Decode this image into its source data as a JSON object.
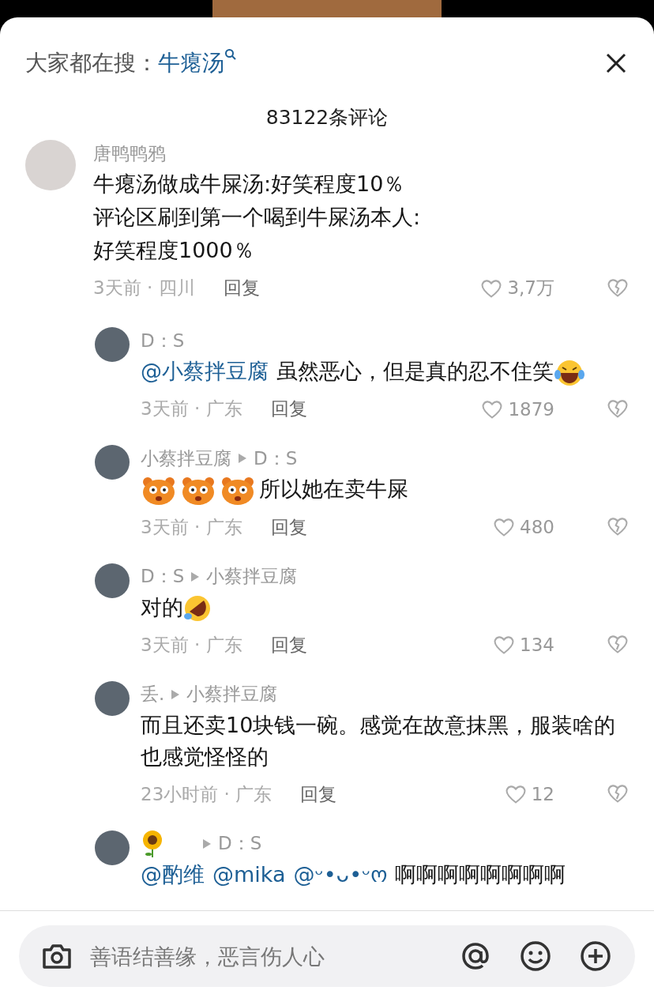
{
  "header": {
    "prompt": "大家都在搜：",
    "query": "牛瘪汤"
  },
  "comment_count": "83122条评论",
  "comments": [
    {
      "kind": "top",
      "author": {
        "kind": "text",
        "text": "唐鸭鸭鸦"
      },
      "body": [
        [
          {
            "kind": "text",
            "text": "牛瘪汤做成牛屎汤:好笑程度10％"
          }
        ],
        [
          {
            "kind": "text",
            "text": "评论区刷到第一个喝到牛屎汤本人:"
          }
        ],
        [
          {
            "kind": "text",
            "text": "好笑程度1000％"
          }
        ]
      ],
      "time_place": "3天前 · 四川",
      "reply": "回复",
      "likes": "3,7万"
    },
    {
      "kind": "reply",
      "author": {
        "kind": "text",
        "text": "D：S"
      },
      "body": [
        [
          {
            "kind": "mention",
            "text": "@小蔡拌豆腐"
          },
          {
            "kind": "text",
            "text": "虽然恶心，但是真的忍不住笑"
          },
          {
            "kind": "laugh"
          }
        ]
      ],
      "time_place": "3天前 · 广东",
      "reply": "回复",
      "likes": "1879"
    },
    {
      "kind": "reply",
      "author": {
        "kind": "text",
        "text": "小蔡拌豆腐"
      },
      "reply_to": "D：S",
      "body": [
        [
          {
            "kind": "bear"
          },
          {
            "kind": "bear"
          },
          {
            "kind": "bear"
          },
          {
            "kind": "text",
            "text": "所以她在卖牛屎"
          }
        ]
      ],
      "time_place": "3天前 · 广东",
      "reply": "回复",
      "likes": "480"
    },
    {
      "kind": "reply",
      "author": {
        "kind": "text",
        "text": "D：S"
      },
      "reply_to": "小蔡拌豆腐",
      "body": [
        [
          {
            "kind": "text",
            "text": "对的"
          },
          {
            "kind": "rofl"
          }
        ]
      ],
      "time_place": "3天前 · 广东",
      "reply": "回复",
      "likes": "134"
    },
    {
      "kind": "reply",
      "author": {
        "kind": "text",
        "text": "丢."
      },
      "reply_to": "小蔡拌豆腐",
      "body": [
        [
          {
            "kind": "text",
            "text": "而且还卖10块钱一碗。感觉在故意抹黑，服装啥的也感觉怪怪的"
          }
        ]
      ],
      "time_place": "23小时前 · 广东",
      "reply": "回复",
      "likes": "12"
    },
    {
      "kind": "reply",
      "author": {
        "kind": "sunflower"
      },
      "reply_to": "D：S",
      "body": [
        [
          {
            "kind": "mention",
            "text": "@酌维"
          },
          {
            "kind": "mention",
            "text": "@mika"
          },
          {
            "kind": "mention",
            "text": "@ᵕ•ᴗ•ᵕო"
          },
          {
            "kind": "text",
            "text": "啊啊啊啊啊啊啊啊"
          }
        ]
      ]
    }
  ],
  "input": {
    "placeholder": "善语结善缘，恶言伤人心"
  }
}
